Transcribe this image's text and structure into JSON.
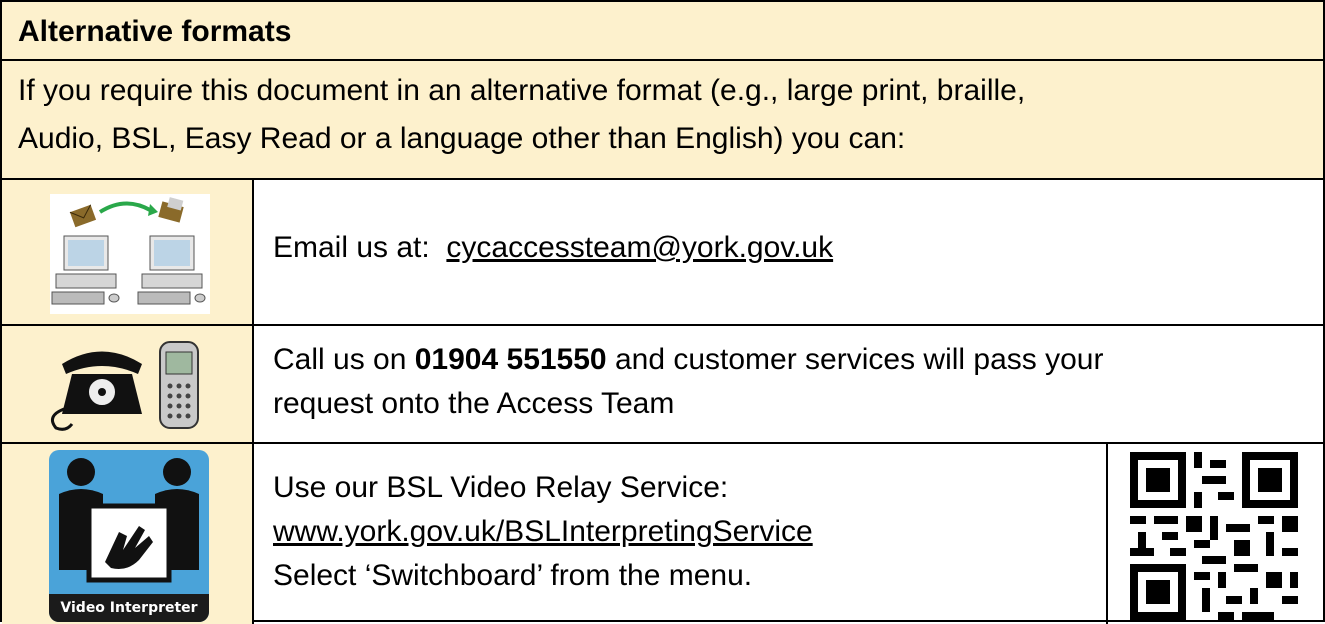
{
  "header": {
    "title": "Alternative formats"
  },
  "intro": {
    "line1": "If you require this document in an alternative format (e.g., large print, braille,",
    "line2": "Audio, BSL, Easy Read or a language other than English) you can:"
  },
  "email": {
    "prefix": "Email us at:",
    "address": "cycaccessteam@york.gov.uk"
  },
  "phone": {
    "prefix": "Call us on",
    "number": "01904 551550",
    "suffix_line1": "and customer services will pass your",
    "line2": "request onto the Access Team"
  },
  "bsl": {
    "line1": "Use our BSL Video Relay Service:",
    "url": "www.york.gov.uk/BSLInterpretingService",
    "line3": "Select ‘Switchboard’ from the menu.",
    "icon_label": "Video Interpreter"
  },
  "icons": {
    "email": "computers-sending-email-icon",
    "phone": "telephone-and-mobile-icon",
    "bsl": "video-interpreter-icon",
    "qr": "qr-code-icon"
  },
  "colors": {
    "panel": "#fdf1cd",
    "vi_blue": "#4aa3d9"
  }
}
